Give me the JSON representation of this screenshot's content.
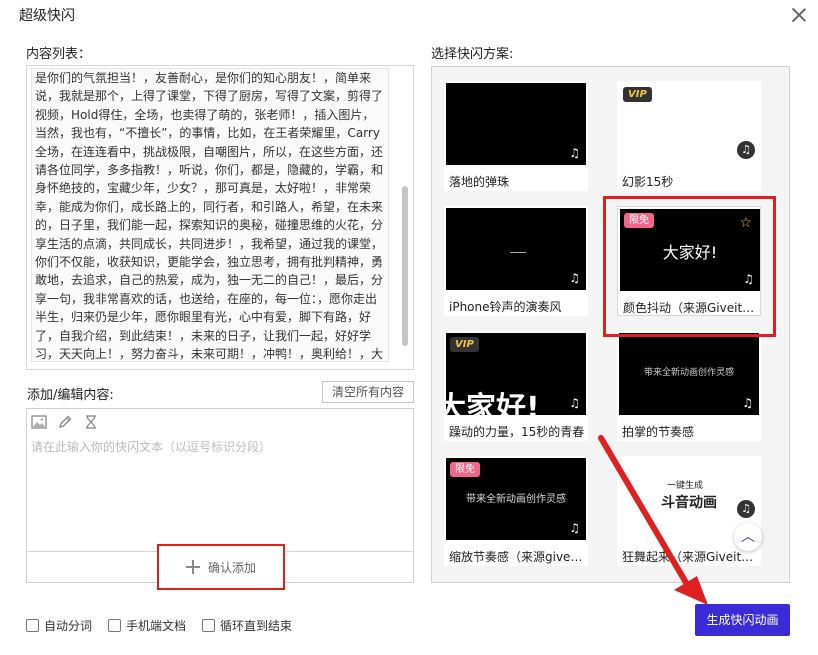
{
  "dialog": {
    "title": "超级快闪"
  },
  "content_list": {
    "label": "内容列表：",
    "text": "是你们的气氛担当！，友善耐心，是你们的知心朋友！，简单来说，我就是那个，上得了课堂，下得了厨房，写得了文案，剪得了视频，Hold得住，全场，也卖得了萌的，张老师！，插入图片，当然，我也有，“不擅长”，的事情，比如，在王者荣耀里，Carry全场，在连连看中，挑战极限，自嘲图片，所以，在这些方面，还请各位同学，多多指教！，听说，你们，都是，隐藏的，学霸，和身怀绝技的，宝藏少年，少女？，那可真是，太好啦！，非常荣幸，能成为你们，成长路上的，同行者，和引路人，希望，在未来的，日子里，我们能一起，探索知识的奥秘，碰撞思维的火花，分享生活的点滴，共同成长，共同进步！，我希望，通过我的课堂，你们不仅能，收获知识，更能学会，独立思考，拥有批判精神，勇敢地，去追求，自己的热爱，成为，独一无二的自己！，最后，分享一句，我非常喜欢的话，也送给，在座的，每一位：，愿你走出半生，归来仍是少年，愿你眼里有光，心中有爱，脚下有路，好了，自我介绍，到此结束！，未来的日子，让我们一起，好好学习，天天向上！，努力奋斗，未来可期！，冲鸭！，奥利给！，大大的赞！"
  },
  "edit": {
    "label": "添加/编辑内容:",
    "clear_label": "清空所有内容",
    "placeholder": "请在此输入你的快闪文本（以逗号标识分段）",
    "confirm_label": "确认添加"
  },
  "scheme": {
    "label": "选择快闪方案:",
    "cards": [
      {
        "name": "落地的弹珠",
        "badge": "",
        "thumb_text": "",
        "thumb_style": "black"
      },
      {
        "name": "幻影15秒",
        "badge": "VIP",
        "thumb_text": "",
        "thumb_style": "white"
      },
      {
        "name": "iPhone铃声的演奏风",
        "badge": "",
        "thumb_text": "",
        "thumb_style": "black"
      },
      {
        "name": "颜色抖动（来源Giveitu…",
        "badge": "限免",
        "thumb_text": "大家好!",
        "thumb_style": "black"
      },
      {
        "name": "躁动的力量，15秒的青春",
        "badge": "VIP",
        "thumb_text": "大家好!",
        "thumb_style": "black"
      },
      {
        "name": "拍掌的节奏感",
        "badge": "",
        "thumb_text": "带来全新动画创作灵感",
        "thumb_style": "black"
      },
      {
        "name": "缩放节奏感（来源giveit…",
        "badge": "限免",
        "thumb_text": "带来全新动画创作灵感",
        "thumb_style": "black"
      },
      {
        "name": "狂舞起来（来源Giveitu…",
        "badge": "",
        "thumb_text": "一键生成",
        "thumb_text2": "斗音动画",
        "thumb_style": "white"
      }
    ]
  },
  "options": {
    "auto_segment": "自动分词",
    "phone_doc": "手机端文档",
    "loop_until_end": "循环直到结束"
  },
  "generate_label": "生成快闪动画",
  "icons": {
    "close": "close-icon",
    "image": "image-icon",
    "pen": "pen-icon",
    "timer": "hourglass-icon",
    "music": "music-note-icon",
    "star": "star-icon",
    "up": "chevron-up-icon"
  },
  "colors": {
    "accent": "#3b2bd6",
    "highlight": "#e02020",
    "free_badge": "#f2668b",
    "vip_gold": "#f2c44b"
  }
}
